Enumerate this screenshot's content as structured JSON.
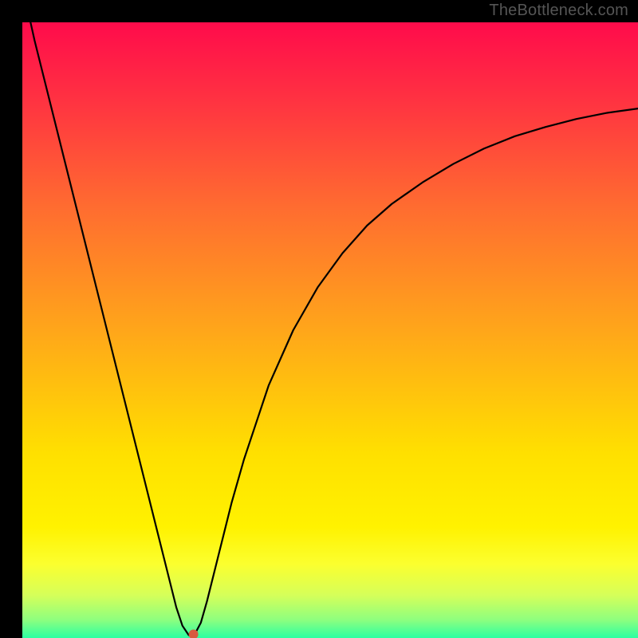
{
  "watermark": "TheBottleneck.com",
  "chart_data": {
    "type": "line",
    "title": "",
    "xlabel": "",
    "ylabel": "",
    "xlim": [
      0,
      100
    ],
    "ylim": [
      0,
      100
    ],
    "grid": false,
    "legend": false,
    "background_gradient": {
      "stops": [
        {
          "offset": 0.0,
          "color": "#ff0b4b"
        },
        {
          "offset": 0.12,
          "color": "#ff3042"
        },
        {
          "offset": 0.3,
          "color": "#ff6c30"
        },
        {
          "offset": 0.5,
          "color": "#ffa61a"
        },
        {
          "offset": 0.7,
          "color": "#ffe000"
        },
        {
          "offset": 0.82,
          "color": "#fff200"
        },
        {
          "offset": 0.88,
          "color": "#fbff2f"
        },
        {
          "offset": 0.93,
          "color": "#d6ff59"
        },
        {
          "offset": 0.97,
          "color": "#8fff7e"
        },
        {
          "offset": 1.0,
          "color": "#2bffa2"
        }
      ]
    },
    "curve": {
      "x": [
        0,
        2,
        4,
        6,
        8,
        10,
        12,
        14,
        16,
        18,
        20,
        22,
        24,
        25,
        26,
        27,
        27.5,
        28,
        29,
        30,
        32,
        34,
        36,
        38,
        40,
        44,
        48,
        52,
        56,
        60,
        65,
        70,
        75,
        80,
        85,
        90,
        95,
        100
      ],
      "y": [
        106,
        97,
        89,
        81,
        73,
        65,
        57,
        49,
        41,
        33,
        25,
        17,
        9,
        5,
        2,
        0.5,
        0.2,
        0.6,
        2.5,
        6,
        14,
        22,
        29,
        35,
        41,
        50,
        57,
        62.5,
        67,
        70.5,
        74,
        77,
        79.5,
        81.5,
        83,
        84.3,
        85.3,
        86
      ]
    },
    "marker": {
      "x": 27.8,
      "y": 0.6,
      "color": "#d85a3f",
      "r": 6
    }
  }
}
